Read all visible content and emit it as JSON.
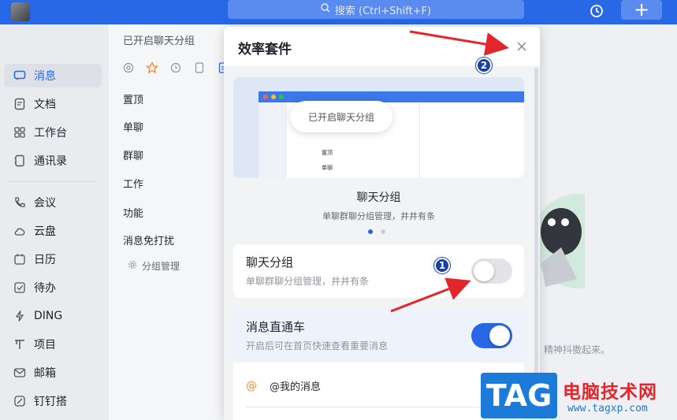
{
  "topbar": {
    "search_placeholder": "搜索 (Ctrl+Shift+F)",
    "icons": [
      "search-icon",
      "history-icon",
      "plus-icon"
    ]
  },
  "sidebar": {
    "items": [
      {
        "label": "消息",
        "icon": "message-icon",
        "active": true
      },
      {
        "label": "文档",
        "icon": "document-icon"
      },
      {
        "label": "工作台",
        "icon": "workbench-icon"
      },
      {
        "label": "通讯录",
        "icon": "contacts-icon"
      },
      {
        "label": "会议",
        "icon": "meeting-icon"
      },
      {
        "label": "云盘",
        "icon": "cloud-icon"
      },
      {
        "label": "日历",
        "icon": "calendar-icon"
      },
      {
        "label": "待办",
        "icon": "todo-icon"
      },
      {
        "label": "DING",
        "icon": "ding-icon"
      },
      {
        "label": "项目",
        "icon": "project-icon"
      },
      {
        "label": "邮箱",
        "icon": "mail-icon"
      },
      {
        "label": "钉钉搭",
        "icon": "builder-icon"
      }
    ]
  },
  "midpanel": {
    "title": "已开启聊天分组",
    "groups": [
      "置顶",
      "单聊",
      "群聊",
      "工作",
      "功能",
      "消息免打扰"
    ],
    "manage_label": "分组管理"
  },
  "modal": {
    "title": "效率套件",
    "preview_bubble": "已开启聊天分组",
    "preview_rows": [
      "置顶",
      "单聊"
    ],
    "feature_title": "聊天分组",
    "feature_desc": "单聊群聊分组管理，井井有条",
    "settings": [
      {
        "title": "聊天分组",
        "desc": "单聊群聊分组管理，井井有条",
        "enabled": false
      },
      {
        "title": "消息直通车",
        "desc": "开启后可在首页快速查看重要消息",
        "enabled": true
      }
    ],
    "mention_label": "@我的消息"
  },
  "right": {
    "caption": "精神抖擞起来。"
  },
  "annotations": {
    "badge1": "1",
    "badge2": "2"
  },
  "watermark": {
    "logo": "TAG",
    "title": "电脑技术网",
    "url": "www.tagxp.com"
  },
  "colors": {
    "accent": "#2867e6",
    "toggle_on": "#2867e6",
    "toggle_off": "#e2e4e8",
    "arrow": "#e3262b"
  }
}
